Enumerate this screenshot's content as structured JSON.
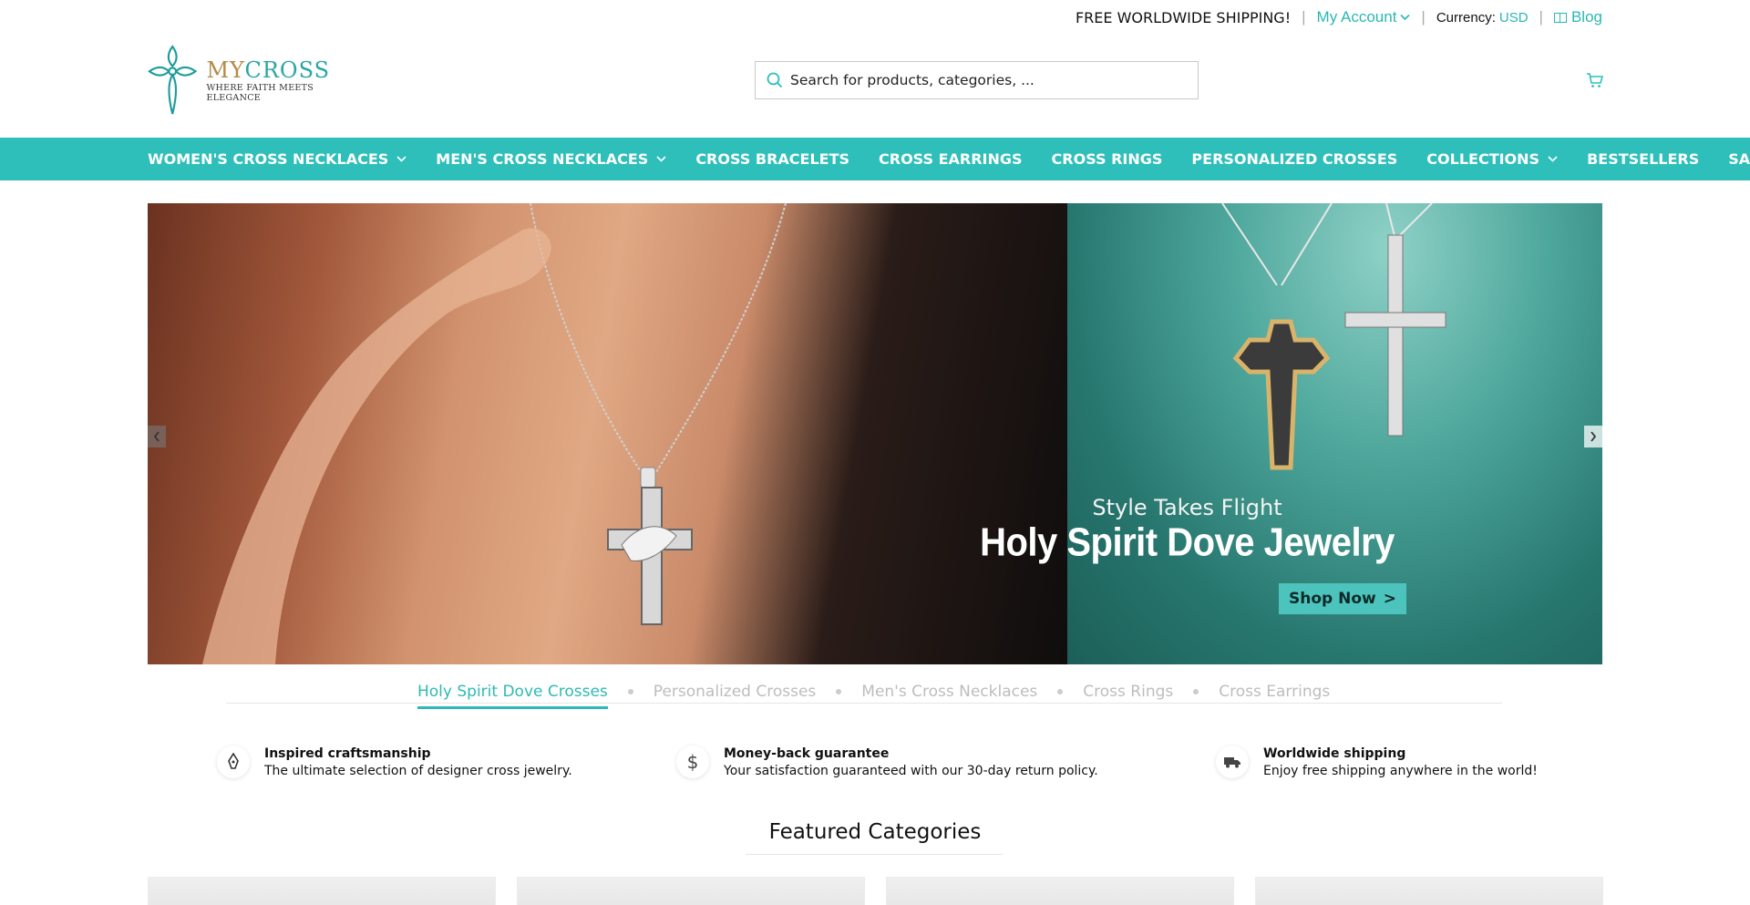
{
  "topbar": {
    "free_shipping": "FREE WORLDWIDE SHIPPING!",
    "my_account": "My Account",
    "currency_label": "Currency:",
    "currency_value": "USD",
    "blog": "Blog"
  },
  "brand": {
    "name_part1": "MY",
    "name_part2": "CROSS",
    "tagline": "WHERE FAITH MEETS ELEGANCE"
  },
  "search": {
    "placeholder": "Search for products, categories, ..."
  },
  "nav": {
    "items": [
      {
        "label": "WOMEN'S CROSS NECKLACES"
      },
      {
        "label": "MEN'S CROSS NECKLACES"
      },
      {
        "label": "CROSS BRACELETS"
      },
      {
        "label": "CROSS EARRINGS"
      },
      {
        "label": "CROSS RINGS"
      },
      {
        "label": "PERSONALIZED CROSSES"
      },
      {
        "label": "COLLECTIONS"
      },
      {
        "label": "BESTSELLERS"
      },
      {
        "label": "SALE"
      }
    ]
  },
  "hero": {
    "subtitle": "Style Takes Flight",
    "title": "Holy Spirit Dove Jewelry",
    "button": "Shop Now",
    "button_arrow": ">"
  },
  "slider_tabs": [
    {
      "label": "Holy Spirit Dove Crosses"
    },
    {
      "label": "Personalized Crosses"
    },
    {
      "label": "Men's Cross Necklaces"
    },
    {
      "label": "Cross Rings"
    },
    {
      "label": "Cross Earrings"
    }
  ],
  "features": [
    {
      "title": "Inspired craftsmanship",
      "desc": "The ultimate selection of designer cross jewelry.",
      "icon": "pen-nib-icon"
    },
    {
      "title": "Money-back guarantee",
      "desc": "Your satisfaction guaranteed with our 30-day return policy.",
      "icon": "dollar-icon"
    },
    {
      "title": "Worldwide shipping",
      "desc": "Enjoy free shipping anywhere in the world!",
      "icon": "truck-icon"
    }
  ],
  "featured_categories": {
    "title": "Featured Categories"
  },
  "colors": {
    "accent": "#2ebfba",
    "gold": "#b58a45"
  }
}
